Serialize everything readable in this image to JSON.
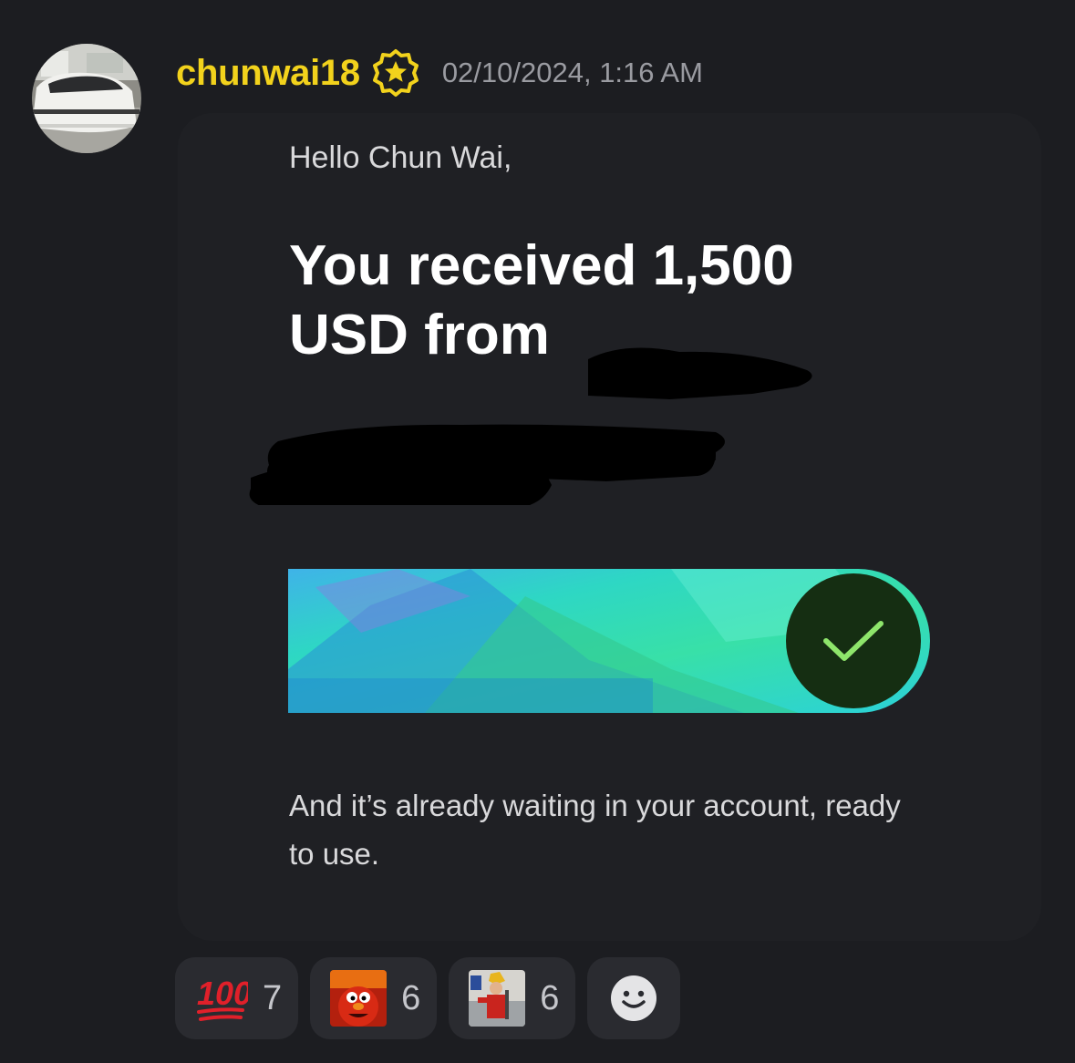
{
  "message": {
    "username": "chunwai18",
    "timestamp": "02/10/2024, 1:16 AM",
    "avatar_icon": "car-photo-avatar",
    "badge_icon": "star-badge-icon"
  },
  "embed": {
    "greeting": "Hello Chun Wai,",
    "headline": "You received 1,500 USD from",
    "card_icon": "checkmark-icon",
    "body": "And it’s already waiting in your account, ready to use."
  },
  "reactions": [
    {
      "emoji": "hundred-points-icon",
      "count": "7"
    },
    {
      "emoji": "elmo-fire-emoji",
      "count": "6"
    },
    {
      "emoji": "custom-figure-emoji",
      "count": "6"
    }
  ],
  "add_reaction_icon": "smiley-add-reaction-icon",
  "colors": {
    "background": "#1c1d21",
    "username": "#f2d21c",
    "embed_bg": "#1f2024",
    "reaction_bg": "#2a2b30",
    "check_green": "#8ee56b"
  }
}
